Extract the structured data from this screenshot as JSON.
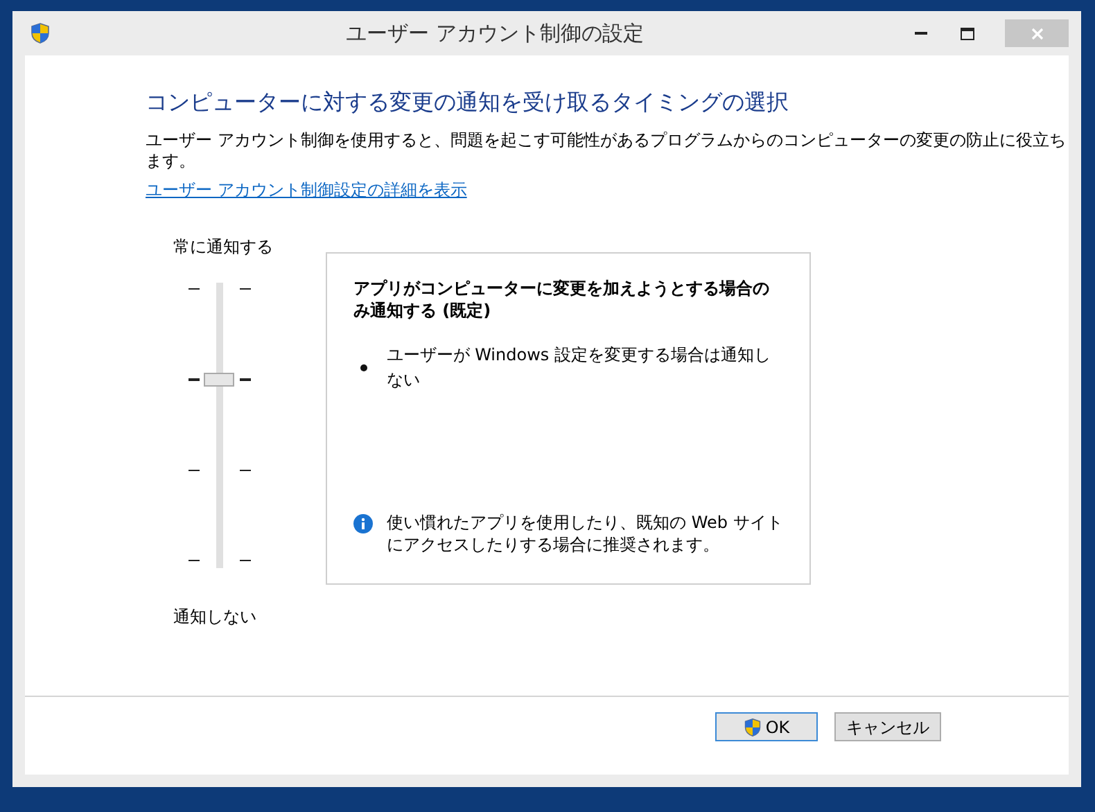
{
  "window": {
    "title": "ユーザー アカウント制御の設定"
  },
  "heading": "コンピューターに対する変更の通知を受け取るタイミングの選択",
  "description": "ユーザー アカウント制御を使用すると、問題を起こす可能性があるプログラムからのコンピューターの変更の防止に役立ちます。",
  "link": "ユーザー アカウント制御設定の詳細を表示",
  "slider": {
    "top_label": "常に通知する",
    "bottom_label": "通知しない",
    "level": 0.667
  },
  "info_panel": {
    "title": "アプリがコンピューターに変更を加えようとする場合のみ通知する (既定)",
    "bullets": [
      "ユーザーが Windows 設定を変更する場合は通知しない"
    ],
    "note": "使い慣れたアプリを使用したり、既知の Web サイトにアクセスしたりする場合に推奨されます。"
  },
  "buttons": [
    {
      "label": "OK",
      "kind": "primary"
    },
    {
      "label": "キャンセル",
      "kind": "normal"
    }
  ]
}
